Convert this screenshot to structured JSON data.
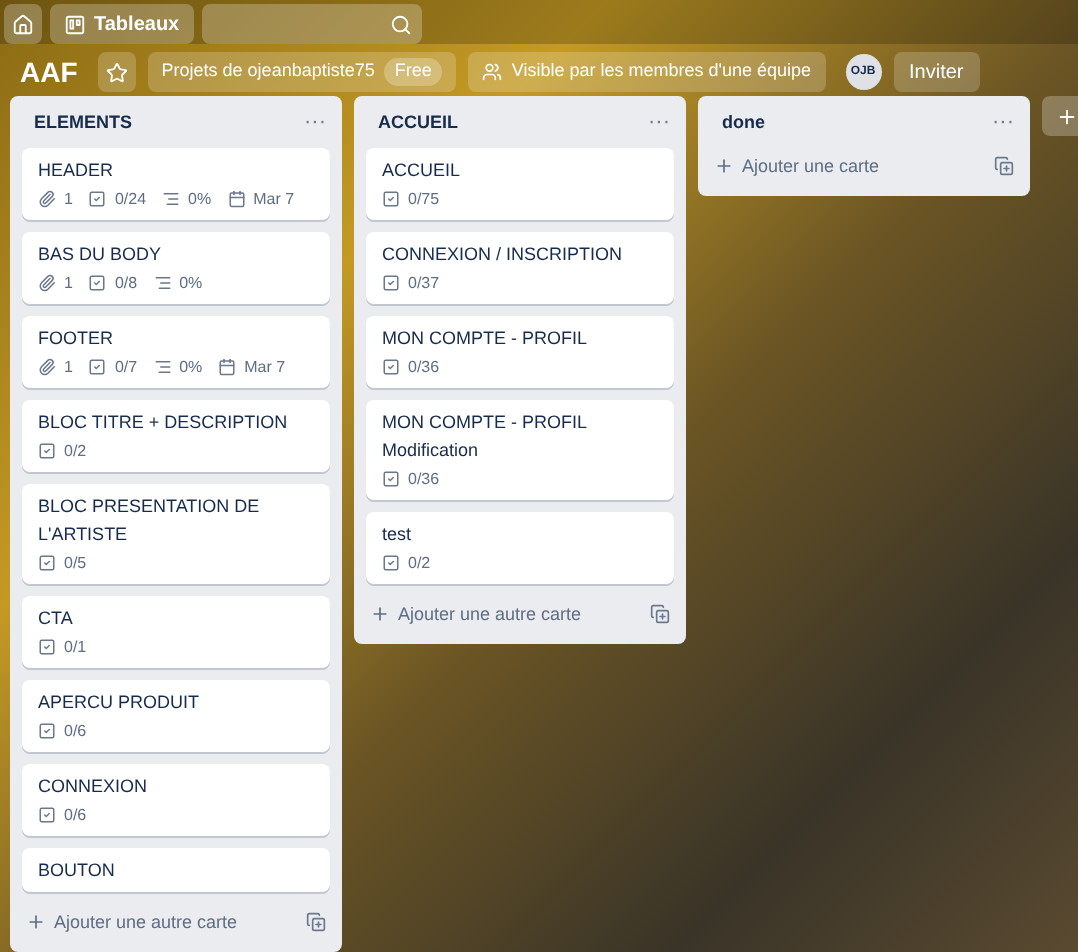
{
  "top_bar": {
    "boards_button": "Tableaux"
  },
  "board_bar": {
    "title": "AAF",
    "starred": false,
    "team": "Projets de ojeanbaptiste75",
    "plan": "Free",
    "visibility": "Visible par les membres d'une équipe",
    "member": "OJB",
    "invite": "Inviter"
  },
  "lists": [
    {
      "title": "ELEMENTS",
      "menu": "···",
      "add": "Ajouter une autre carte",
      "cards": [
        {
          "title": "HEADER",
          "badges": [
            {
              "kind": "attachment",
              "text": "1"
            },
            {
              "kind": "checklist",
              "text": "0/24"
            },
            {
              "kind": "progress",
              "text": "0%"
            },
            {
              "kind": "due",
              "text": "Mar 7"
            }
          ]
        },
        {
          "title": "BAS DU BODY",
          "badges": [
            {
              "kind": "attachment",
              "text": "1"
            },
            {
              "kind": "checklist",
              "text": "0/8"
            },
            {
              "kind": "progress",
              "text": "0%"
            }
          ]
        },
        {
          "title": "FOOTER",
          "badges": [
            {
              "kind": "attachment",
              "text": "1"
            },
            {
              "kind": "checklist",
              "text": "0/7"
            },
            {
              "kind": "progress",
              "text": "0%"
            },
            {
              "kind": "due",
              "text": "Mar 7"
            }
          ]
        },
        {
          "title": "BLOC TITRE + DESCRIPTION",
          "badges": [
            {
              "kind": "checklist",
              "text": "0/2"
            }
          ]
        },
        {
          "title": "BLOC PRESENTATION DE L'ARTISTE",
          "badges": [
            {
              "kind": "checklist",
              "text": "0/5"
            }
          ]
        },
        {
          "title": "CTA",
          "badges": [
            {
              "kind": "checklist",
              "text": "0/1"
            }
          ]
        },
        {
          "title": "APERCU PRODUIT",
          "badges": [
            {
              "kind": "checklist",
              "text": "0/6"
            }
          ]
        },
        {
          "title": "CONNEXION",
          "badges": [
            {
              "kind": "checklist",
              "text": "0/6"
            }
          ]
        },
        {
          "title": "BOUTON"
        }
      ]
    },
    {
      "title": "ACCUEIL",
      "menu": "···",
      "add": "Ajouter une autre carte",
      "cards": [
        {
          "title": "ACCUEIL",
          "badges": [
            {
              "kind": "checklist",
              "text": "0/75"
            }
          ]
        },
        {
          "title": "CONNEXION / INSCRIPTION",
          "badges": [
            {
              "kind": "checklist",
              "text": "0/37"
            }
          ]
        },
        {
          "title": "MON COMPTE - PROFIL",
          "badges": [
            {
              "kind": "checklist",
              "text": "0/36"
            }
          ]
        },
        {
          "title": "MON COMPTE - PROFIL Modification",
          "badges": [
            {
              "kind": "checklist",
              "text": "0/36"
            }
          ]
        },
        {
          "title": "test",
          "badges": [
            {
              "kind": "checklist",
              "text": "0/2"
            }
          ]
        }
      ]
    },
    {
      "title": "done",
      "menu": "···",
      "add": "Ajouter une carte"
    }
  ]
}
